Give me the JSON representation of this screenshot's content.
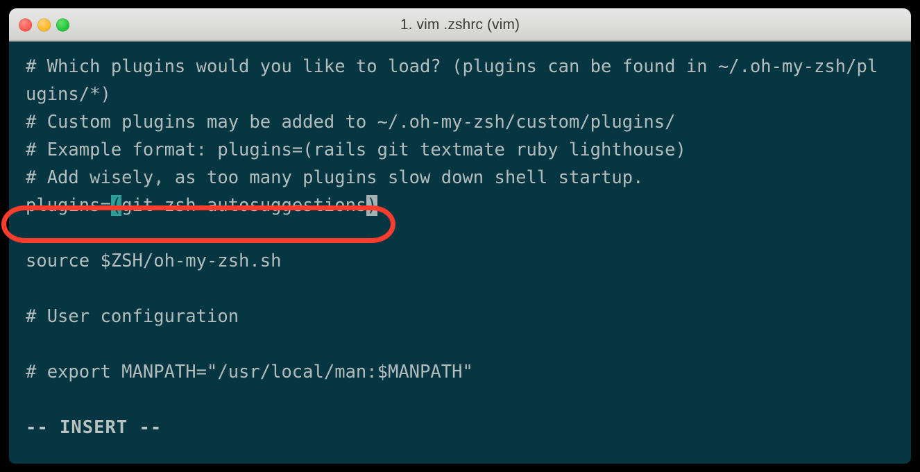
{
  "window": {
    "title": "1. vim .zshrc (vim)",
    "traffic_lights": [
      {
        "name": "close",
        "color": "#ff5f57"
      },
      {
        "name": "minimize",
        "color": "#febc2e"
      },
      {
        "name": "maximize",
        "color": "#28c840"
      }
    ]
  },
  "theme": {
    "background": "#063642",
    "foreground": "#b3bdbd",
    "titlebar_background": "#dededd",
    "titlebar_text": "#3b3b3b",
    "match_highlight": "#2aa198",
    "cursor_background": "#a9b2b2",
    "annotation_color": "#fc3d2e"
  },
  "editor": {
    "lines": [
      "# Which plugins would you like to load? (plugins can be found in ~/.oh-my-zsh/pl",
      "ugins/*)",
      "# Custom plugins may be added to ~/.oh-my-zsh/custom/plugins/",
      "# Example format: plugins=(rails git textmate ruby lighthouse)",
      "# Add wisely, as too many plugins slow down shell startup.",
      "",
      "",
      "source $ZSH/oh-my-zsh.sh",
      "",
      "# User configuration",
      "",
      "# export MANPATH=\"/usr/local/man:$MANPATH\"",
      ""
    ],
    "plugins_line": {
      "prefix": "plugins=",
      "open_paren": "(",
      "contents": "git zsh-autosuggestions",
      "close_paren": ")"
    },
    "status_line": "-- INSERT --"
  },
  "annotation": {
    "shape": "ellipse",
    "label": "plugins-line-highlight"
  }
}
